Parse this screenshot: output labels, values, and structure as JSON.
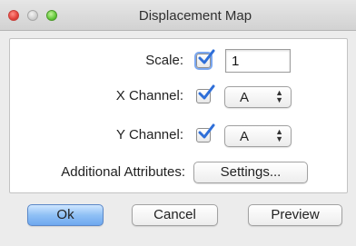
{
  "window": {
    "title": "Displacement Map"
  },
  "form": {
    "scale": {
      "label": "Scale:",
      "checked": true,
      "value": "1"
    },
    "x_channel": {
      "label": "X Channel:",
      "checked": true,
      "selected": "A"
    },
    "y_channel": {
      "label": "Y Channel:",
      "checked": true,
      "selected": "A"
    },
    "additional": {
      "label": "Additional Attributes:",
      "button_label": "Settings..."
    }
  },
  "buttons": {
    "ok": "Ok",
    "cancel": "Cancel",
    "preview": "Preview"
  },
  "colors": {
    "accent": "#2f6fd8",
    "default_button": "#8fc0f5"
  },
  "icons": {
    "close": "close-button-red",
    "minimize": "minimize-button-gray",
    "zoom": "zoom-button-green",
    "checkmark": "checkmark-icon",
    "popup_arrows": "updown-arrows-icon"
  }
}
